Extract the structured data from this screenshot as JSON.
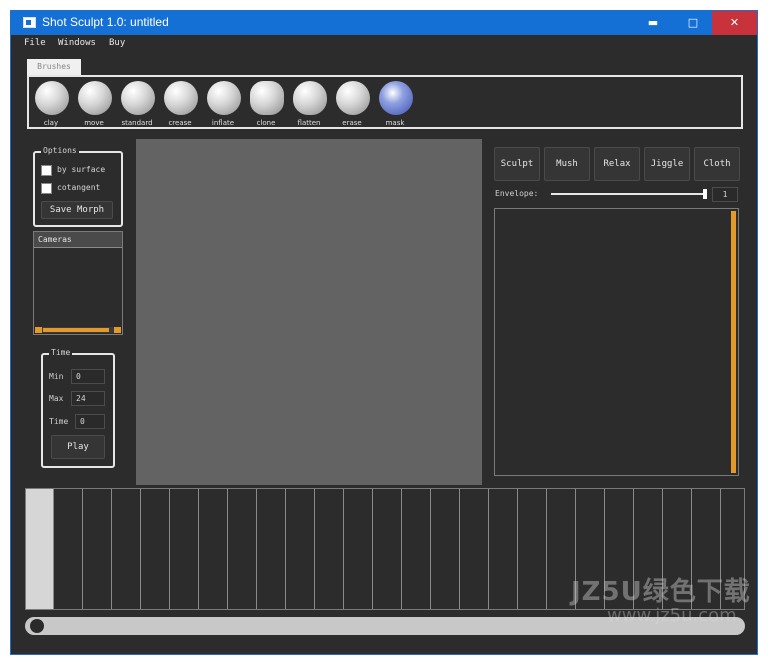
{
  "window": {
    "title": "Shot Sculpt 1.0: untitled",
    "minimize_glyph": "▬",
    "maximize_glyph": "□",
    "close_glyph": "✕",
    "accent_color": "#1570d6"
  },
  "menu": [
    "File",
    "Windows",
    "Buy"
  ],
  "brushes": {
    "tab_label": "Brushes",
    "items": [
      "clay",
      "move",
      "standard",
      "crease",
      "inflate",
      "clone",
      "flatten",
      "erase",
      "mask"
    ]
  },
  "options": {
    "title": "Options",
    "by_surface": "by surface",
    "cotangent": "cotangent",
    "save_morph": "Save Morph"
  },
  "cameras": {
    "header": "Cameras"
  },
  "time": {
    "title": "Time",
    "min_label": "Min",
    "min_value": "0",
    "max_label": "Max",
    "max_value": "24",
    "time_label": "Time",
    "time_value": "0",
    "play": "Play"
  },
  "modes": [
    "Sculpt",
    "Mush",
    "Relax",
    "Jiggle",
    "Cloth"
  ],
  "envelope": {
    "label": "Envelope:",
    "value": "1"
  },
  "watermark": {
    "line1": "JZ5U绿色下载",
    "line2": "www.jz5u.com"
  }
}
